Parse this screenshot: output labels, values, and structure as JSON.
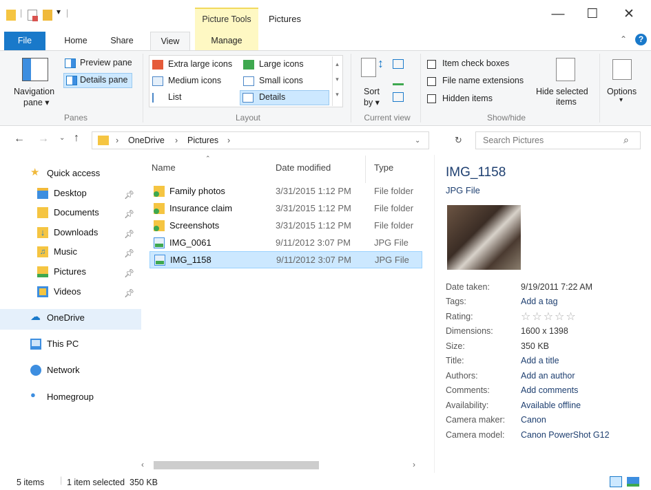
{
  "window": {
    "title": "Pictures",
    "context_tab": "Picture Tools",
    "controls": {
      "minimize": "—",
      "maximize": "☐",
      "close": "✕"
    }
  },
  "ribbon_tabs": [
    {
      "label": "File"
    },
    {
      "label": "Home"
    },
    {
      "label": "Share"
    },
    {
      "label": "View"
    },
    {
      "label": "Manage"
    }
  ],
  "ribbon": {
    "panes": {
      "navigation_pane_line1": "Navigation",
      "navigation_pane_line2": "pane ▾",
      "preview_pane": "Preview pane",
      "details_pane": "Details pane",
      "group_label": "Panes"
    },
    "layout": {
      "extra_large_icons": "Extra large icons",
      "large_icons": "Large icons",
      "medium_icons": "Medium icons",
      "small_icons": "Small icons",
      "list": "List",
      "details": "Details",
      "group_label": "Layout"
    },
    "current_view": {
      "sort_line1": "Sort",
      "sort_line2": "by ▾",
      "group_label": "Current view"
    },
    "show_hide": {
      "item_check_boxes": "Item check boxes",
      "file_name_extensions": "File name extensions",
      "hidden_items": "Hidden items",
      "hide_selected_line1": "Hide selected",
      "hide_selected_line2": "items",
      "group_label": "Show/hide"
    },
    "options": {
      "label": "Options",
      "arrow": "▾"
    }
  },
  "address": {
    "crumbs": [
      "OneDrive",
      "Pictures"
    ],
    "search_placeholder": "Search Pictures"
  },
  "nav": {
    "quick_access": "Quick access",
    "items": [
      {
        "label": "Desktop"
      },
      {
        "label": "Documents"
      },
      {
        "label": "Downloads"
      },
      {
        "label": "Music"
      },
      {
        "label": "Pictures"
      },
      {
        "label": "Videos"
      }
    ],
    "onedrive": "OneDrive",
    "this_pc": "This PC",
    "network": "Network",
    "homegroup": "Homegroup"
  },
  "files": {
    "columns": {
      "name": "Name",
      "date": "Date modified",
      "type": "Type"
    },
    "rows": [
      {
        "name": "Family photos",
        "date": "3/31/2015 1:12 PM",
        "type": "File folder",
        "kind": "folder"
      },
      {
        "name": "Insurance claim",
        "date": "3/31/2015 1:12 PM",
        "type": "File folder",
        "kind": "folder"
      },
      {
        "name": "Screenshots",
        "date": "3/31/2015 1:12 PM",
        "type": "File folder",
        "kind": "folder"
      },
      {
        "name": "IMG_0061",
        "date": "9/11/2012 3:07 PM",
        "type": "JPG File",
        "kind": "image"
      },
      {
        "name": "IMG_1158",
        "date": "9/11/2012 3:07 PM",
        "type": "JPG File",
        "kind": "image",
        "selected": true
      }
    ]
  },
  "details": {
    "title": "IMG_1158",
    "subtitle": "JPG File",
    "props": [
      {
        "k": "Date taken:",
        "v": "9/19/2011 7:22 AM"
      },
      {
        "k": "Tags:",
        "v": "Add a tag"
      },
      {
        "k": "Rating:",
        "v": "☆☆☆☆☆"
      },
      {
        "k": "Dimensions:",
        "v": "1600 x 1398"
      },
      {
        "k": "Size:",
        "v": "350 KB"
      },
      {
        "k": "Title:",
        "v": "Add a title"
      },
      {
        "k": "Authors:",
        "v": "Add an author"
      },
      {
        "k": "Comments:",
        "v": "Add comments"
      },
      {
        "k": "Availability:",
        "v": "Available offline"
      },
      {
        "k": "Camera maker:",
        "v": "Canon"
      },
      {
        "k": "Camera model:",
        "v": "Canon PowerShot G12"
      }
    ]
  },
  "status": {
    "items": "5 items",
    "selected": "1 item selected  350 KB"
  },
  "colors": {
    "accent": "#1979ca",
    "selection": "#cce8ff",
    "context_tab": "#fef8c3"
  }
}
